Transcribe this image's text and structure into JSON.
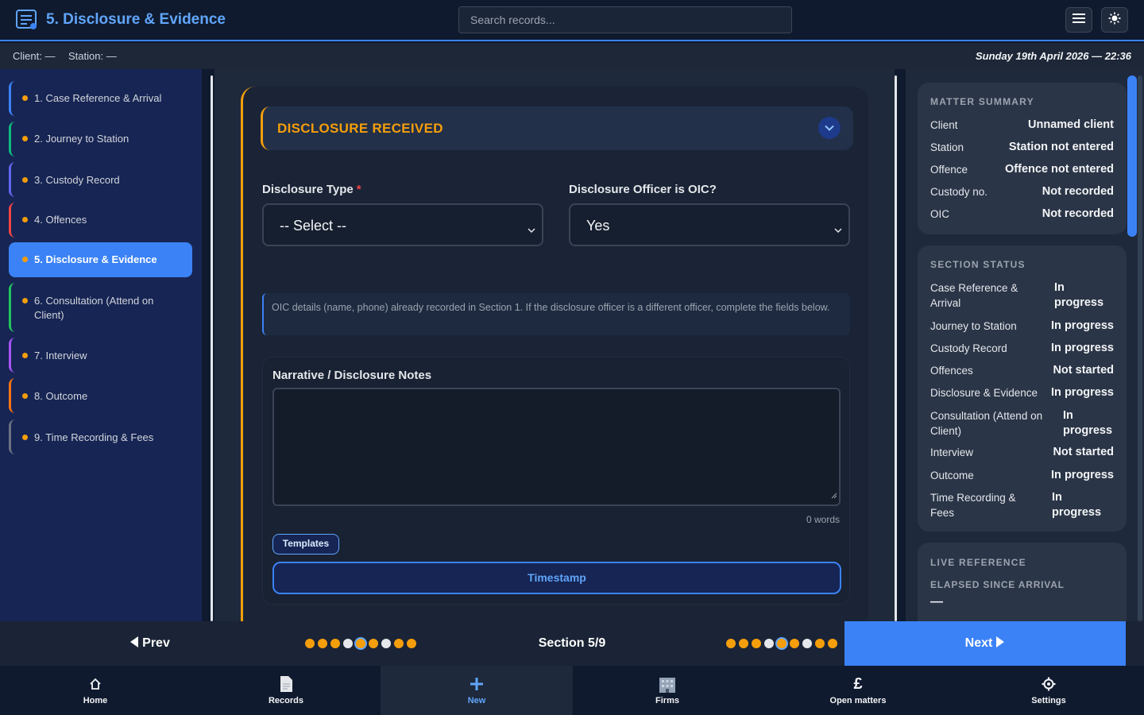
{
  "header": {
    "title": "5. Disclosure & Evidence",
    "search_placeholder": "Search records..."
  },
  "subbar": {
    "client": "Client: —",
    "station": "Station: —",
    "datetime": "Sunday 19th April 2026 — 22:36"
  },
  "sidebar": {
    "items": [
      {
        "label": "1. Case Reference & Arrival",
        "color": "#3b82f6"
      },
      {
        "label": "2. Journey to Station",
        "color": "#10b981"
      },
      {
        "label": "3. Custody Record",
        "color": "#6366f1"
      },
      {
        "label": "4. Offences",
        "color": "#ef4444"
      },
      {
        "label": "5. Disclosure & Evidence",
        "color": "#3b82f6",
        "active": true
      },
      {
        "label": "6. Consultation (Attend on Client)",
        "color": "#22c55e"
      },
      {
        "label": "7. Interview",
        "color": "#a855f7"
      },
      {
        "label": "8. Outcome",
        "color": "#f97316"
      },
      {
        "label": "9. Time Recording & Fees",
        "color": "#6b7280"
      }
    ]
  },
  "section": {
    "title": "DISCLOSURE RECEIVED",
    "disclosure_type_label": "Disclosure Type",
    "required_mark": "*",
    "disclosure_type_value": "-- Select --",
    "officer_label": "Disclosure Officer is OIC?",
    "officer_value": "Yes",
    "info_text": "OIC details (name, phone) already recorded in Section 1. If the disclosure officer is a different officer, complete the fields below.",
    "notes_label": "Narrative / Disclosure Notes",
    "word_count": "0 words",
    "templates_label": "Templates",
    "timestamp_label": "Timestamp"
  },
  "matter_summary": {
    "title": "MATTER SUMMARY",
    "rows": [
      {
        "k": "Client",
        "v": "Unnamed client"
      },
      {
        "k": "Station",
        "v": "Station not entered"
      },
      {
        "k": "Offence",
        "v": "Offence not entered"
      },
      {
        "k": "Custody no.",
        "v": "Not recorded"
      },
      {
        "k": "OIC",
        "v": "Not recorded"
      }
    ]
  },
  "section_status": {
    "title": "SECTION STATUS",
    "rows": [
      {
        "k": "Case Reference & Arrival",
        "v": "In progress"
      },
      {
        "k": "Journey to Station",
        "v": "In progress"
      },
      {
        "k": "Custody Record",
        "v": "In progress"
      },
      {
        "k": "Offences",
        "v": "Not started"
      },
      {
        "k": "Disclosure & Evidence",
        "v": "In progress"
      },
      {
        "k": "Consultation (Attend on Client)",
        "v": "In progress"
      },
      {
        "k": "Interview",
        "v": "Not started"
      },
      {
        "k": "Outcome",
        "v": "In progress"
      },
      {
        "k": "Time Recording & Fees",
        "v": "In progress"
      }
    ]
  },
  "live_reference": {
    "title": "LIVE REFERENCE",
    "elapsed_label": "ELAPSED SINCE ARRIVAL",
    "elapsed_value": "—"
  },
  "navbar": {
    "prev_label": "Prev",
    "next_label": "Next",
    "section_count": "Section 5/9",
    "current_section": 5,
    "total_sections": 9
  },
  "tabs": [
    {
      "label": "Home",
      "icon": "home-icon"
    },
    {
      "label": "Records",
      "icon": "document-icon"
    },
    {
      "label": "New",
      "icon": "plus-icon",
      "active": true
    },
    {
      "label": "Firms",
      "icon": "building-icon"
    },
    {
      "label": "Open matters",
      "icon": "pound-icon"
    },
    {
      "label": "Settings",
      "icon": "gear-icon"
    }
  ],
  "colors": {
    "accent": "#3b82f6",
    "warning": "#f59e0b",
    "background": "#0f1a2e"
  }
}
